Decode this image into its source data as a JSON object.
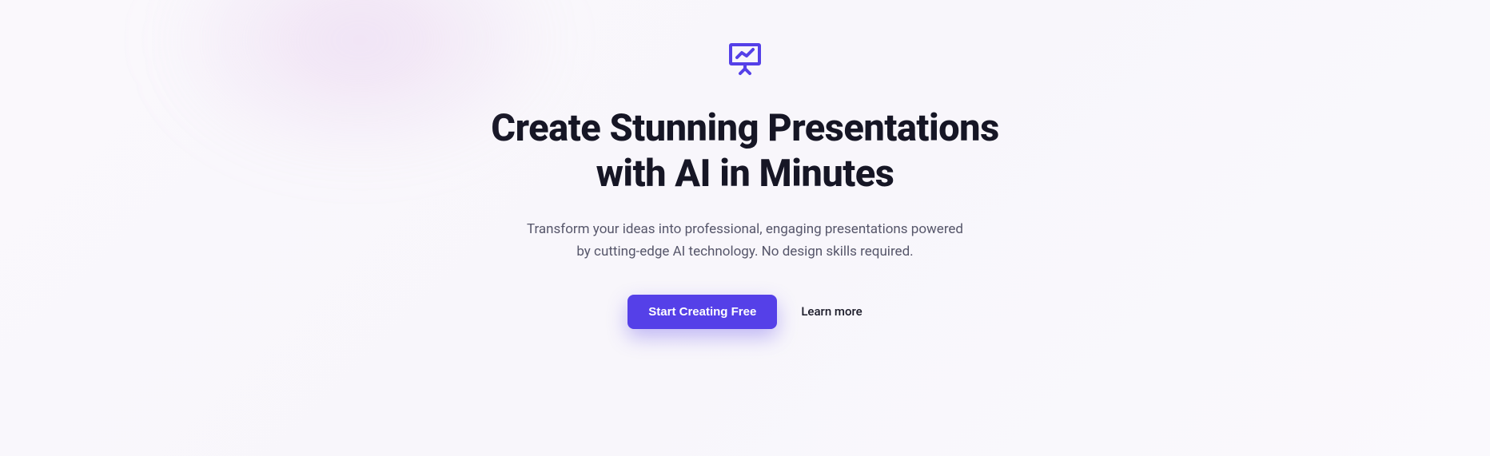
{
  "hero": {
    "headline_line1": "Create Stunning Presentations",
    "headline_line2": "with AI in Minutes",
    "subhead": "Transform your ideas into professional, engaging presentations powered by cutting-edge AI technology. No design skills required.",
    "cta_primary": "Start Creating Free",
    "cta_secondary": "Learn more"
  }
}
